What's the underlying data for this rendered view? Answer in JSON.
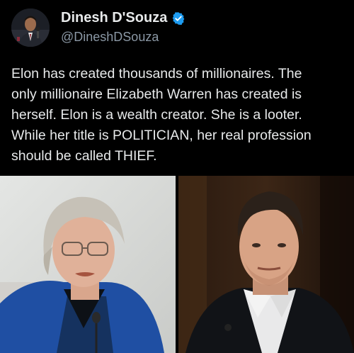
{
  "author": {
    "display_name": "Dinesh D'Souza",
    "handle": "@DineshDSouza",
    "verified": true,
    "verified_color": "#1d9bf0",
    "avatar_icon": "profile-photo-icon"
  },
  "tweet": {
    "lines": [
      "Elon has created thousands of millionaires. The",
      "only millionaire Elizabeth Warren has created is",
      "herself. Elon is a wealth creator. She is a looter.",
      "While her title is POLITICIAN, her real profession",
      "should be called THIEF."
    ]
  },
  "media": {
    "count": 2,
    "images": [
      "left-photo",
      "right-photo"
    ]
  },
  "colors": {
    "background": "#000000",
    "text": "#e7e9ea",
    "secondary_text": "#8b98a5"
  }
}
